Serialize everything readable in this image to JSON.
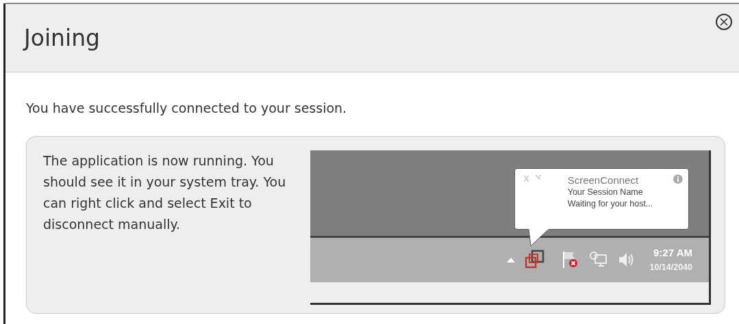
{
  "dialog": {
    "title": "Joining",
    "message": "You have successfully connected to your session.",
    "instructions": "The application is now running. You should see it in your system tray. You can right click and select Exit to disconnect manually."
  },
  "tray_preview": {
    "balloon": {
      "close": "X",
      "app_name": "ScreenConnect",
      "session_name": "Your Session Name",
      "status": "Waiting for your host..."
    },
    "time": "9:27 AM",
    "date": "10/14/2040"
  }
}
